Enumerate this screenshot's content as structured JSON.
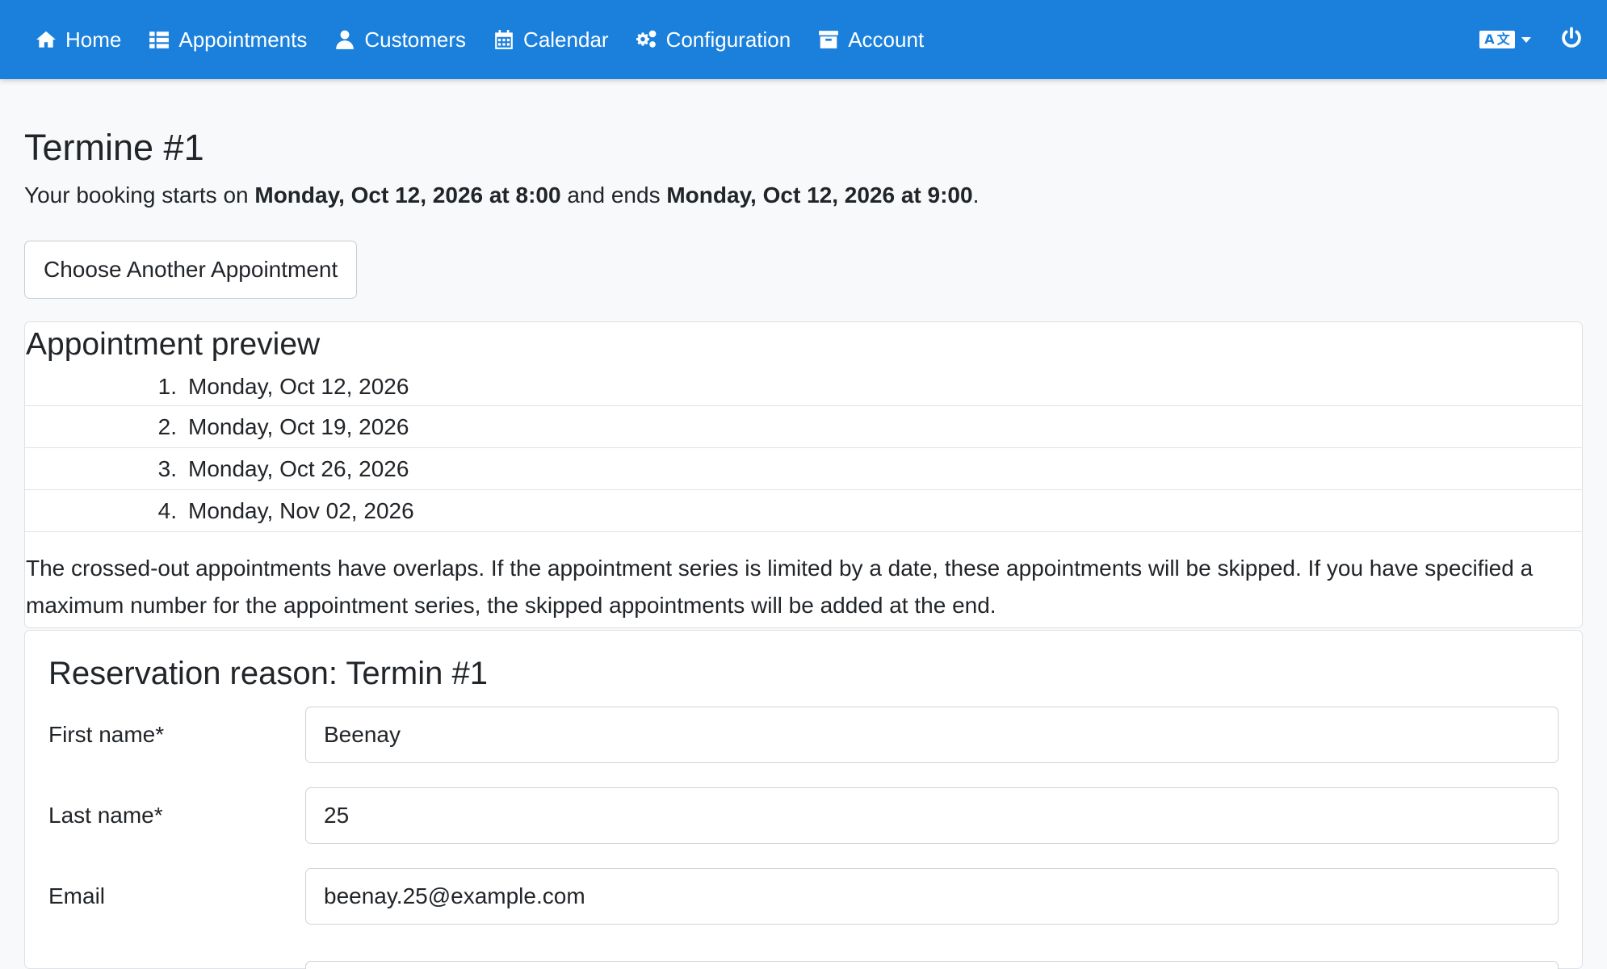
{
  "nav": {
    "items": [
      {
        "label": "Home",
        "icon": "home-icon"
      },
      {
        "label": "Appointments",
        "icon": "list-icon"
      },
      {
        "label": "Customers",
        "icon": "user-icon"
      },
      {
        "label": "Calendar",
        "icon": "calendar-icon"
      },
      {
        "label": "Configuration",
        "icon": "gears-icon"
      },
      {
        "label": "Account",
        "icon": "archive-icon"
      }
    ],
    "language_icon": "language-icon",
    "logout_icon": "power-icon",
    "bg_color": "#1a80dc"
  },
  "page": {
    "title": "Termine #1",
    "summary_prefix": "Your booking starts on ",
    "start": "Monday, Oct 12, 2026 at 8:00",
    "summary_middle": " and ends ",
    "end": "Monday, Oct 12, 2026 at 9:00",
    "summary_suffix": ".",
    "choose_button": "Choose Another Appointment"
  },
  "preview": {
    "title": "Appointment preview",
    "items": [
      {
        "num": "1.",
        "date": "Monday, Oct 12, 2026"
      },
      {
        "num": "2.",
        "date": "Monday, Oct 19, 2026"
      },
      {
        "num": "3.",
        "date": "Monday, Oct 26, 2026"
      },
      {
        "num": "4.",
        "date": "Monday, Nov 02, 2026"
      }
    ],
    "note": "The crossed-out appointments have overlaps. If the appointment series is limited by a date, these appointments will be skipped. If you have specified a maximum number for the appointment series, the skipped appointments will be added at the end."
  },
  "reservation": {
    "title": "Reservation reason: Termin #1",
    "first_name_label": "First name*",
    "first_name_value": "Beenay",
    "last_name_label": "Last name*",
    "last_name_value": "25",
    "email_label": "Email",
    "email_value": "beenay.25@example.com"
  }
}
